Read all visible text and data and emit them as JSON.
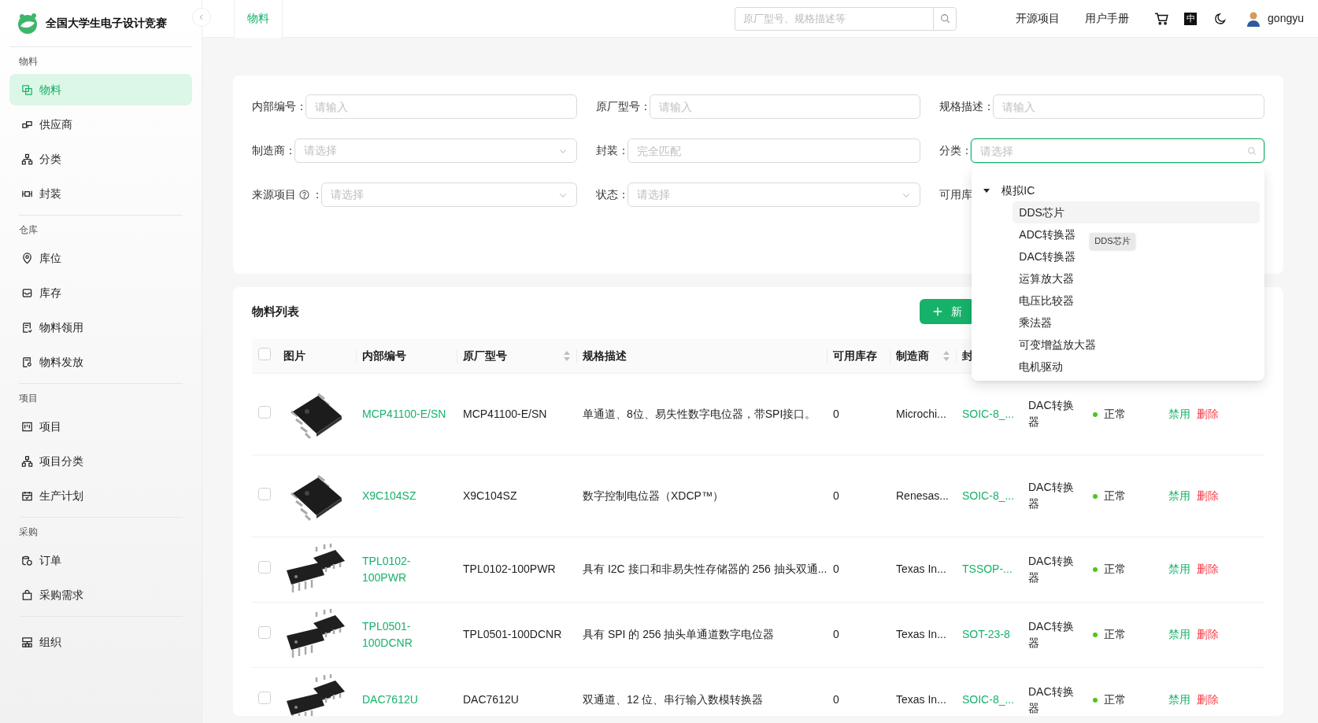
{
  "brand": {
    "title": "全国大学生电子设计竞赛"
  },
  "sidebar": {
    "groups": [
      {
        "label": "物料",
        "items": [
          {
            "label": "物料",
            "selected": true
          },
          {
            "label": "供应商",
            "selected": false
          },
          {
            "label": "分类",
            "selected": false
          },
          {
            "label": "封装",
            "selected": false
          }
        ]
      },
      {
        "label": "仓库",
        "items": [
          {
            "label": "库位",
            "selected": false
          },
          {
            "label": "库存",
            "selected": false
          },
          {
            "label": "物料领用",
            "selected": false
          },
          {
            "label": "物料发放",
            "selected": false
          }
        ]
      },
      {
        "label": "项目",
        "items": [
          {
            "label": "项目",
            "selected": false
          },
          {
            "label": "项目分类",
            "selected": false
          },
          {
            "label": "生产计划",
            "selected": false
          }
        ]
      },
      {
        "label": "采购",
        "items": [
          {
            "label": "订单",
            "selected": false
          },
          {
            "label": "采购需求",
            "selected": false
          }
        ]
      },
      {
        "items": [
          {
            "label": "组织",
            "selected": false
          }
        ]
      }
    ]
  },
  "top_bar": {
    "tabs": [
      {
        "label": "物料",
        "selected": true
      }
    ],
    "search": {
      "placeholder": "原厂型号、规格描述等"
    },
    "links": [
      "开源项目",
      "用户手册"
    ],
    "language": "中",
    "user": {
      "name": "gongyu"
    }
  },
  "filters": [
    {
      "kind": "input",
      "label": "内部编号",
      "colon": "：",
      "placeholder": "请输入"
    },
    {
      "kind": "input",
      "label": "原厂型号",
      "colon": "：",
      "placeholder": "请输入"
    },
    {
      "kind": "input",
      "label": "规格描述",
      "colon": "：",
      "placeholder": "请输入"
    },
    {
      "kind": "select",
      "label": "制造商",
      "colon": "：",
      "placeholder": "请选择"
    },
    {
      "kind": "input",
      "label": "封装",
      "colon": "：",
      "placeholder": "完全匹配"
    },
    {
      "kind": "search-select",
      "label": "分类",
      "colon": "：",
      "placeholder": "请选择",
      "focused": true
    },
    {
      "kind": "select",
      "label": "来源项目",
      "help": true,
      "colon": "：",
      "placeholder": "请选择"
    },
    {
      "kind": "select",
      "label": "状态",
      "colon": "：",
      "placeholder": "请选择"
    },
    {
      "kind": "label",
      "label": "可用库"
    }
  ],
  "category_dropdown": {
    "tree": [
      {
        "label": "模拟IC",
        "expanded": true,
        "children": [
          {
            "label": "DDS芯片",
            "hovered": true
          },
          {
            "label": "ADC转换器",
            "hovered": false
          },
          {
            "label": "DAC转换器",
            "hovered": false
          },
          {
            "label": "运算放大器",
            "hovered": false
          },
          {
            "label": "电压比较器",
            "hovered": false
          },
          {
            "label": "乘法器",
            "hovered": false
          },
          {
            "label": "可变增益放大器",
            "hovered": false
          },
          {
            "label": "电机驱动",
            "hovered": false
          }
        ]
      }
    ],
    "tooltip": "DDS芯片"
  },
  "table": {
    "title": "物料列表",
    "add_button": "新",
    "all_selected": false,
    "columns": [
      {
        "label": "图片",
        "sortable": false
      },
      {
        "label": "内部编号",
        "sortable": false
      },
      {
        "label": "原厂型号",
        "sortable": true
      },
      {
        "label": "规格描述",
        "sortable": false
      },
      {
        "label": "可用库存",
        "sortable": false
      },
      {
        "label": "制造商",
        "sortable": true
      },
      {
        "label": "封",
        "sortable": false
      }
    ],
    "rows": [
      {
        "selected": false,
        "internal_no": "MCP41100-E/SN",
        "part_no": "MCP41100-E/SN",
        "description": "单通道、8位、易失性数字电位器，带SPI接口。",
        "stock": "0",
        "manufacturer": "Microchi...",
        "package": "SOIC-8_...",
        "category": "DAC转换器",
        "status": "正常",
        "actions": [
          "禁用",
          "删除"
        ]
      },
      {
        "selected": false,
        "internal_no": "X9C104SZ",
        "part_no": "X9C104SZ",
        "description": "数字控制电位器（XDCP™）",
        "stock": "0",
        "manufacturer": "Renesas...",
        "package": "SOIC-8_...",
        "category": "DAC转换器",
        "status": "正常",
        "actions": [
          "禁用",
          "删除"
        ]
      },
      {
        "selected": false,
        "internal_no": "TPL0102-100PWR",
        "part_no": "TPL0102-100PWR",
        "description": "具有 I2C 接口和非易失性存储器的 256 抽头双通...",
        "stock": "0",
        "manufacturer": "Texas In...",
        "package": "TSSOP-...",
        "category": "DAC转换器",
        "status": "正常",
        "actions": [
          "禁用",
          "删除"
        ]
      },
      {
        "selected": false,
        "internal_no": "TPL0501-100DCNR",
        "part_no": "TPL0501-100DCNR",
        "description": "具有 SPI 的 256 抽头单通道数字电位器",
        "stock": "0",
        "manufacturer": "Texas In...",
        "package": "SOT-23-8",
        "category": "DAC转换器",
        "status": "正常",
        "actions": [
          "禁用",
          "删除"
        ]
      },
      {
        "selected": false,
        "internal_no": "DAC7612U",
        "part_no": "DAC7612U",
        "description": "双通道、12 位、串行输入数模转换器",
        "stock": "0",
        "manufacturer": "Texas In...",
        "package": "SOIC-8_...",
        "category": "DAC转换器",
        "status": "正常",
        "actions": [
          "禁用",
          "删除"
        ]
      }
    ]
  }
}
